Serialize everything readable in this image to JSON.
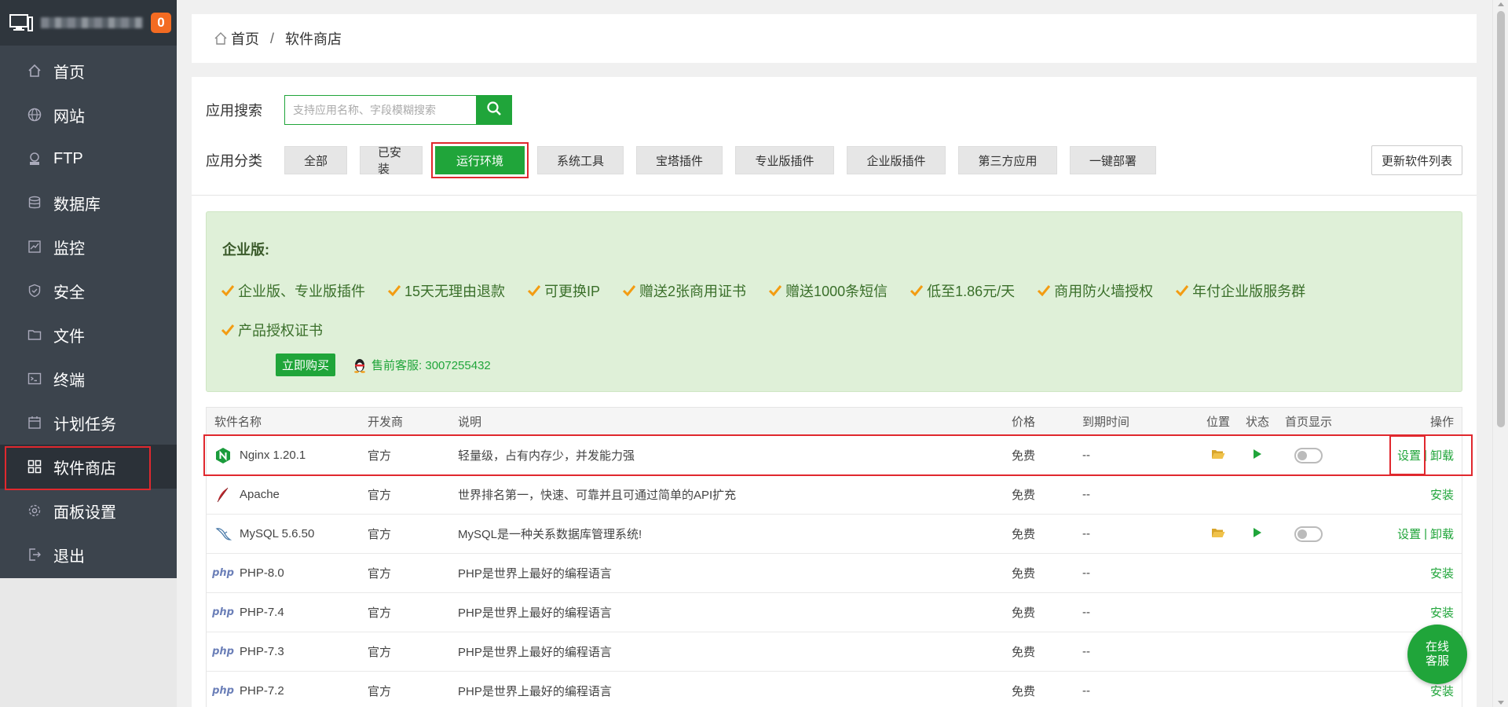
{
  "sidebar": {
    "badge": "0",
    "items": [
      {
        "label": "首页",
        "icon": "home-icon"
      },
      {
        "label": "网站",
        "icon": "globe-icon"
      },
      {
        "label": "FTP",
        "icon": "ftp-icon"
      },
      {
        "label": "数据库",
        "icon": "database-icon"
      },
      {
        "label": "监控",
        "icon": "monitor-chart-icon"
      },
      {
        "label": "安全",
        "icon": "shield-icon"
      },
      {
        "label": "文件",
        "icon": "folder-icon"
      },
      {
        "label": "终端",
        "icon": "terminal-icon"
      },
      {
        "label": "计划任务",
        "icon": "calendar-icon"
      },
      {
        "label": "软件商店",
        "icon": "grid-icon",
        "active": true
      },
      {
        "label": "面板设置",
        "icon": "gear-icon"
      },
      {
        "label": "退出",
        "icon": "logout-icon"
      }
    ]
  },
  "breadcrumb": {
    "home": "首页",
    "sep": "/",
    "current": "软件商店"
  },
  "search": {
    "label": "应用搜索",
    "placeholder": "支持应用名称、字段模糊搜索"
  },
  "categories": {
    "label": "应用分类",
    "items": [
      "全部",
      "已安装",
      "运行环境",
      "系统工具",
      "宝塔插件",
      "专业版插件",
      "企业版插件",
      "第三方应用",
      "一键部署"
    ],
    "active": "运行环境",
    "refresh": "更新软件列表"
  },
  "promo": {
    "title": "企业版:",
    "features": [
      "企业版、专业版插件",
      "15天无理由退款",
      "可更换IP",
      "赠送2张商用证书",
      "赠送1000条短信",
      "低至1.86元/天",
      "商用防火墙授权",
      "年付企业版服务群",
      "产品授权证书"
    ],
    "buy": "立即购买",
    "support": "售前客服: 3007255432"
  },
  "table": {
    "headers": {
      "name": "软件名称",
      "dev": "开发商",
      "desc": "说明",
      "price": "价格",
      "expire": "到期时间",
      "location": "位置",
      "status": "状态",
      "home": "首页显示",
      "op": "操作"
    },
    "rows": [
      {
        "name": "Nginx 1.20.1",
        "dev": "官方",
        "desc": "轻量级，占有内存少，并发能力强",
        "price": "免费",
        "expire": "--",
        "icon": "nginx-icon",
        "installed": true,
        "op_set": "设置",
        "op_sep": "|",
        "op_uninstall": "卸载"
      },
      {
        "name": "Apache",
        "dev": "官方",
        "desc": "世界排名第一，快速、可靠并且可通过简单的API扩充",
        "price": "免费",
        "expire": "--",
        "icon": "apache-feather-icon",
        "installed": false,
        "op_install": "安装"
      },
      {
        "name": "MySQL 5.6.50",
        "dev": "官方",
        "desc": "MySQL是一种关系数据库管理系统!",
        "price": "免费",
        "expire": "--",
        "icon": "mysql-dolphin-icon",
        "installed": true,
        "op_set": "设置",
        "op_sep": "|",
        "op_uninstall": "卸载"
      },
      {
        "name": "PHP-8.0",
        "dev": "官方",
        "desc": "PHP是世界上最好的编程语言",
        "price": "免费",
        "expire": "--",
        "icon": "php-icon",
        "installed": false,
        "op_install": "安装"
      },
      {
        "name": "PHP-7.4",
        "dev": "官方",
        "desc": "PHP是世界上最好的编程语言",
        "price": "免费",
        "expire": "--",
        "icon": "php-icon",
        "installed": false,
        "op_install": "安装"
      },
      {
        "name": "PHP-7.3",
        "dev": "官方",
        "desc": "PHP是世界上最好的编程语言",
        "price": "免费",
        "expire": "--",
        "icon": "php-icon",
        "installed": false,
        "op_install": "安装"
      },
      {
        "name": "PHP-7.2",
        "dev": "官方",
        "desc": "PHP是世界上最好的编程语言",
        "price": "免费",
        "expire": "--",
        "icon": "php-icon",
        "installed": false,
        "op_install": "安装"
      }
    ],
    "php_logo": "php"
  },
  "chat": {
    "line1": "在线",
    "line2": "客服"
  },
  "colors": {
    "accent": "#20a53a",
    "sidebar": "#3c444d",
    "highlight": "#e0282e",
    "badge": "#f36b22"
  }
}
